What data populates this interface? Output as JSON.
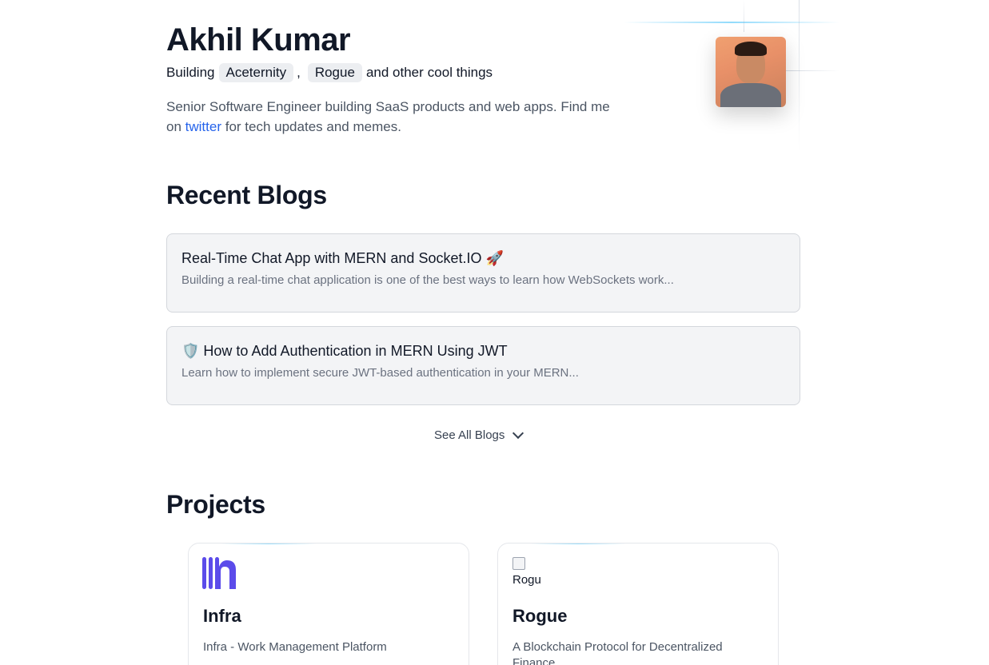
{
  "profile": {
    "name": "Akhil Kumar",
    "building_prefix": "Building",
    "chip1": "Aceternity",
    "separator": ",",
    "chip2": "Rogue",
    "and_other": "and other",
    "cool_things": "cool things",
    "bio_part1": "Senior Software Engineer building SaaS products and web apps. Find me on",
    "bio_link": "twitter",
    "bio_part2": "for tech updates and memes."
  },
  "blogs": {
    "heading": "Recent Blogs",
    "items": [
      {
        "title": "Real-Time Chat App with MERN and Socket.IO 🚀",
        "desc": "Building a real-time chat application is one of the best ways to learn how WebSockets work..."
      },
      {
        "title": "🛡️ How to Add Authentication in MERN Using JWT",
        "desc": "Learn how to implement secure JWT-based authentication in your MERN..."
      }
    ],
    "see_all": "See All Blogs"
  },
  "projects": {
    "heading": "Projects",
    "items": [
      {
        "title": "Infra",
        "desc": "Infra - Work Management Platform",
        "logo_color": "#4f46e5"
      },
      {
        "title": "Rogue",
        "desc": "A Blockchain Protocol for Decentralized Finance",
        "image_alt": "Rogu"
      }
    ]
  },
  "colors": {
    "link": "#2563eb",
    "accent": "#38bdf8"
  }
}
